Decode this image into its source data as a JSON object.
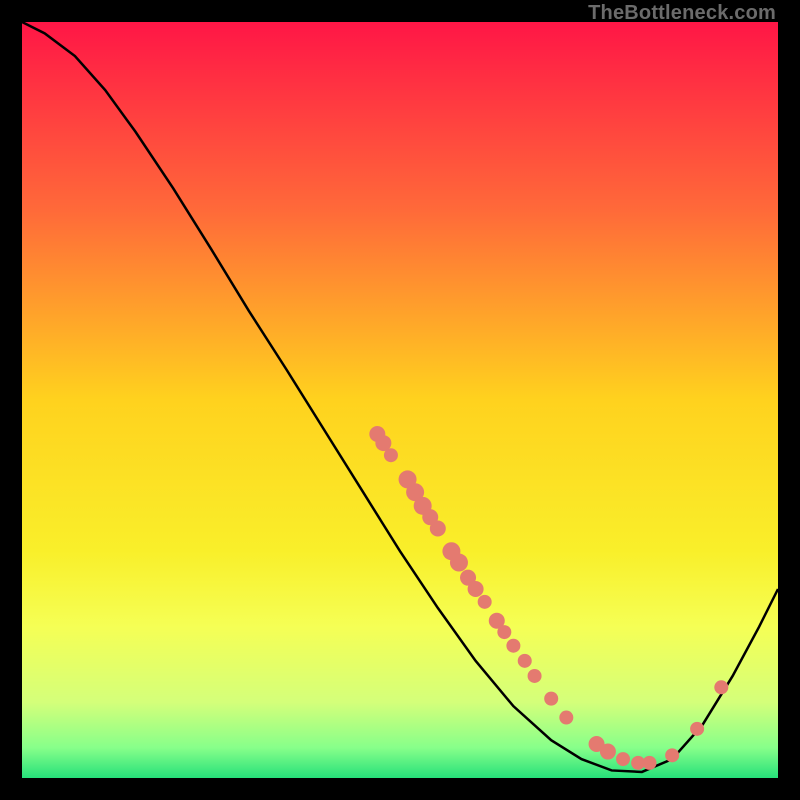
{
  "watermark": "TheBottleneck.com",
  "chart_data": {
    "type": "line",
    "title": "",
    "xlabel": "",
    "ylabel": "",
    "xlim": [
      0,
      1
    ],
    "ylim": [
      0,
      1
    ],
    "background_gradient": {
      "stops": [
        {
          "offset": 0.0,
          "color": "#ff1646"
        },
        {
          "offset": 0.25,
          "color": "#ff6a39"
        },
        {
          "offset": 0.5,
          "color": "#ffd21e"
        },
        {
          "offset": 0.7,
          "color": "#f9ef2a"
        },
        {
          "offset": 0.8,
          "color": "#f5ff55"
        },
        {
          "offset": 0.9,
          "color": "#d4ff7a"
        },
        {
          "offset": 0.96,
          "color": "#87ff8a"
        },
        {
          "offset": 1.0,
          "color": "#26e07a"
        }
      ]
    },
    "curve": [
      {
        "x": 0.0,
        "y": 1.0
      },
      {
        "x": 0.03,
        "y": 0.985
      },
      {
        "x": 0.07,
        "y": 0.955
      },
      {
        "x": 0.11,
        "y": 0.91
      },
      {
        "x": 0.15,
        "y": 0.855
      },
      {
        "x": 0.2,
        "y": 0.78
      },
      {
        "x": 0.25,
        "y": 0.7
      },
      {
        "x": 0.3,
        "y": 0.618
      },
      {
        "x": 0.35,
        "y": 0.54
      },
      {
        "x": 0.4,
        "y": 0.46
      },
      {
        "x": 0.45,
        "y": 0.38
      },
      {
        "x": 0.5,
        "y": 0.3
      },
      {
        "x": 0.55,
        "y": 0.225
      },
      {
        "x": 0.6,
        "y": 0.155
      },
      {
        "x": 0.65,
        "y": 0.095
      },
      {
        "x": 0.7,
        "y": 0.05
      },
      {
        "x": 0.74,
        "y": 0.025
      },
      {
        "x": 0.78,
        "y": 0.01
      },
      {
        "x": 0.82,
        "y": 0.008
      },
      {
        "x": 0.86,
        "y": 0.025
      },
      {
        "x": 0.9,
        "y": 0.07
      },
      {
        "x": 0.94,
        "y": 0.135
      },
      {
        "x": 0.975,
        "y": 0.2
      },
      {
        "x": 1.0,
        "y": 0.25
      }
    ],
    "scatter": {
      "color": "#e47a70",
      "points": [
        {
          "x": 0.47,
          "y": 0.455,
          "r": 8
        },
        {
          "x": 0.478,
          "y": 0.443,
          "r": 8
        },
        {
          "x": 0.488,
          "y": 0.427,
          "r": 7
        },
        {
          "x": 0.51,
          "y": 0.395,
          "r": 9
        },
        {
          "x": 0.52,
          "y": 0.378,
          "r": 9
        },
        {
          "x": 0.53,
          "y": 0.36,
          "r": 9
        },
        {
          "x": 0.54,
          "y": 0.345,
          "r": 8
        },
        {
          "x": 0.55,
          "y": 0.33,
          "r": 8
        },
        {
          "x": 0.568,
          "y": 0.3,
          "r": 9
        },
        {
          "x": 0.578,
          "y": 0.285,
          "r": 9
        },
        {
          "x": 0.59,
          "y": 0.265,
          "r": 8
        },
        {
          "x": 0.6,
          "y": 0.25,
          "r": 8
        },
        {
          "x": 0.612,
          "y": 0.233,
          "r": 7
        },
        {
          "x": 0.628,
          "y": 0.208,
          "r": 8
        },
        {
          "x": 0.638,
          "y": 0.193,
          "r": 7
        },
        {
          "x": 0.65,
          "y": 0.175,
          "r": 7
        },
        {
          "x": 0.665,
          "y": 0.155,
          "r": 7
        },
        {
          "x": 0.678,
          "y": 0.135,
          "r": 7
        },
        {
          "x": 0.7,
          "y": 0.105,
          "r": 7
        },
        {
          "x": 0.72,
          "y": 0.08,
          "r": 7
        },
        {
          "x": 0.76,
          "y": 0.045,
          "r": 8
        },
        {
          "x": 0.775,
          "y": 0.035,
          "r": 8
        },
        {
          "x": 0.795,
          "y": 0.025,
          "r": 7
        },
        {
          "x": 0.815,
          "y": 0.02,
          "r": 7
        },
        {
          "x": 0.83,
          "y": 0.02,
          "r": 7
        },
        {
          "x": 0.86,
          "y": 0.03,
          "r": 7
        },
        {
          "x": 0.893,
          "y": 0.065,
          "r": 7
        },
        {
          "x": 0.925,
          "y": 0.12,
          "r": 7
        }
      ]
    }
  }
}
